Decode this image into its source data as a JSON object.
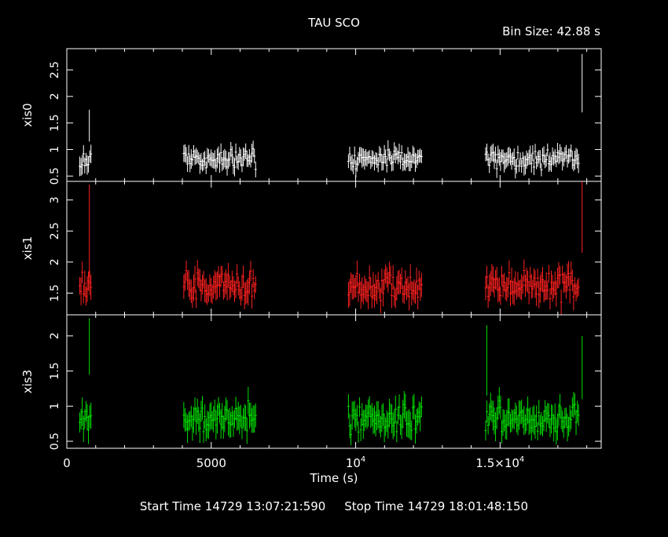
{
  "header": {
    "title": "TAU SCO",
    "bin_size": "Bin Size: 42.88 s"
  },
  "footer": {
    "start_label": "Start Time",
    "start_value": "14729 13:07:21:590",
    "stop_label": "Stop Time",
    "stop_value": "14729 18:01:48:150"
  },
  "chart_data": {
    "type": "scatter",
    "title": "TAU SCO",
    "xlabel": "Time (s)",
    "xlim": [
      0,
      18500
    ],
    "x_ticks": [
      {
        "value": 0,
        "label": "0"
      },
      {
        "value": 5000,
        "label": "5000"
      },
      {
        "value": 10000,
        "label": "10",
        "sup": "4"
      },
      {
        "value": 15000,
        "label": "1.5×10",
        "sup": "4"
      }
    ],
    "grid": false,
    "bin_size_s": 42.88,
    "segments": [
      [
        450,
        870
      ],
      [
        4050,
        6550
      ],
      [
        9750,
        12300
      ],
      [
        14500,
        17750
      ]
    ],
    "series": [
      {
        "name": "xis0",
        "color": "#ffffff",
        "ylim": [
          0.4,
          2.9
        ],
        "yticks": [
          0.5,
          1,
          1.5,
          2,
          2.5
        ],
        "mean": 0.82,
        "spread": 0.13,
        "err": 0.15,
        "spikes": [
          {
            "x": 780,
            "y": 1.45,
            "err": 0.3
          },
          {
            "x": 17840,
            "y": 2.25,
            "err": 0.55
          }
        ]
      },
      {
        "name": "xis1",
        "color": "#ff2020",
        "ylim": [
          1.15,
          3.3
        ],
        "yticks": [
          1.5,
          2,
          2.5,
          3
        ],
        "mean": 1.62,
        "spread": 0.16,
        "err": 0.18,
        "spikes": [
          {
            "x": 780,
            "y": 2.5,
            "err": 0.75
          },
          {
            "x": 17840,
            "y": 2.75,
            "err": 0.6
          }
        ]
      },
      {
        "name": "xis3",
        "color": "#00e000",
        "ylim": [
          0.4,
          2.3
        ],
        "yticks": [
          0.5,
          1,
          1.5,
          2
        ],
        "mean": 0.82,
        "spread": 0.14,
        "err": 0.17,
        "spikes": [
          {
            "x": 780,
            "y": 1.85,
            "err": 0.4
          },
          {
            "x": 14540,
            "y": 1.65,
            "err": 0.5
          },
          {
            "x": 17840,
            "y": 1.55,
            "err": 0.45
          }
        ]
      }
    ]
  }
}
